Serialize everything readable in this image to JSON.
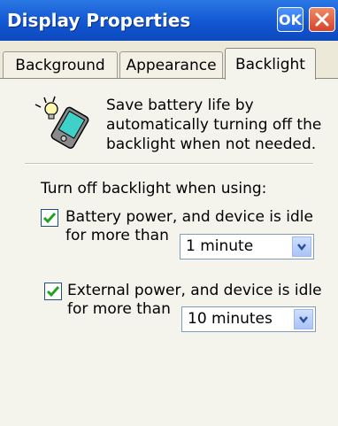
{
  "window": {
    "title": "Display Properties",
    "ok_label": "OK",
    "close_icon": "close-icon"
  },
  "tabs": [
    {
      "label": "Background",
      "active": false
    },
    {
      "label": "Appearance",
      "active": false
    },
    {
      "label": "Backlight",
      "active": true
    }
  ],
  "backlight": {
    "description_lines": [
      "Save battery life by",
      "automatically turning off the",
      "backlight when not needed."
    ],
    "turn_off_label": "Turn off backlight when using:",
    "battery": {
      "checked": true,
      "label_line1": "Battery power, and device is idle",
      "label_line2": "for more than",
      "selected": "1 minute"
    },
    "external": {
      "checked": true,
      "label_line1": "External power, and device is idle",
      "label_line2": "for more than",
      "selected": "10 minutes"
    }
  },
  "colors": {
    "titlebar": "#1256d2",
    "check": "#21a121",
    "panel": "#f5f4ec"
  }
}
